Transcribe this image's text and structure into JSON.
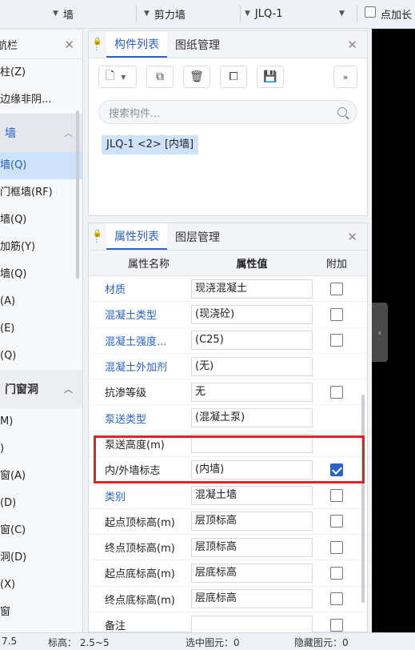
{
  "toolbar": {
    "sel1": "墙",
    "sel2": "剪力墙",
    "sel3": "JLQ-1",
    "checkbox_label": "点加长"
  },
  "leftnav": {
    "title": "航栏",
    "items_top": [
      "柱(Z)",
      "边缘非阴..."
    ],
    "group1": "墙",
    "items_wall": [
      "墙(Q)",
      "门框墙(RF)",
      "墙(Q)",
      "加筋(Y)",
      "墙(Q)",
      "(A)",
      "(E)",
      "(Q)"
    ],
    "group2": "门窗洞",
    "items_door": [
      "M)",
      ")",
      "窗(A)",
      "(D)",
      "窗(C)",
      "洞(D)",
      "(X)",
      "窗"
    ]
  },
  "comp_panel": {
    "tab_active": "构件列表",
    "tab_other": "图纸管理",
    "search_placeholder": "搜索构件...",
    "item": "JLQ-1 <2> [内墙]"
  },
  "prop_panel": {
    "tab_active": "属性列表",
    "tab_other": "图层管理",
    "col_name": "属性名称",
    "col_value": "属性值",
    "col_add": "附加",
    "rows": [
      {
        "name": "材质",
        "value": "现浇混凝土",
        "link": true,
        "cb": true,
        "checked": false
      },
      {
        "name": "混凝土类型",
        "value": "(现浇砼)",
        "link": true,
        "cb": true,
        "checked": false
      },
      {
        "name": "混凝土强度...",
        "value": "(C25)",
        "link": true,
        "cb": true,
        "checked": false
      },
      {
        "name": "混凝土外加剂",
        "value": "(无)",
        "link": true,
        "cb": false,
        "checked": false
      },
      {
        "name": "抗渗等级",
        "value": "无",
        "link": false,
        "cb": true,
        "checked": false
      },
      {
        "name": "泵送类型",
        "value": "(混凝土泵)",
        "link": true,
        "cb": false,
        "checked": false
      },
      {
        "name": "泵送高度(m)",
        "value": "",
        "link": false,
        "cb": false,
        "checked": false
      },
      {
        "name": "内/外墙标志",
        "value": "(内墙)",
        "link": false,
        "cb": true,
        "checked": true
      },
      {
        "name": "类别",
        "value": "混凝土墙",
        "link": true,
        "cb": true,
        "checked": false
      },
      {
        "name": "起点顶标高(m)",
        "value": "层顶标高",
        "link": false,
        "cb": true,
        "checked": false
      },
      {
        "name": "终点顶标高(m)",
        "value": "层顶标高",
        "link": false,
        "cb": true,
        "checked": false
      },
      {
        "name": "起点底标高(m)",
        "value": "层底标高",
        "link": false,
        "cb": true,
        "checked": false
      },
      {
        "name": "终点底标高(m)",
        "value": "层底标高",
        "link": false,
        "cb": true,
        "checked": false
      },
      {
        "name": "备注",
        "value": "",
        "link": false,
        "cb": true,
        "checked": false
      }
    ]
  },
  "status": {
    "s1": "7.5",
    "s2": "标高： 2.5~5",
    "s3": "选中图元：0",
    "s4": "隐藏图元：0"
  },
  "colors": {
    "accent": "#2a63c9",
    "highlight": "#e02424",
    "selected_bg": "#cfe2fb"
  }
}
